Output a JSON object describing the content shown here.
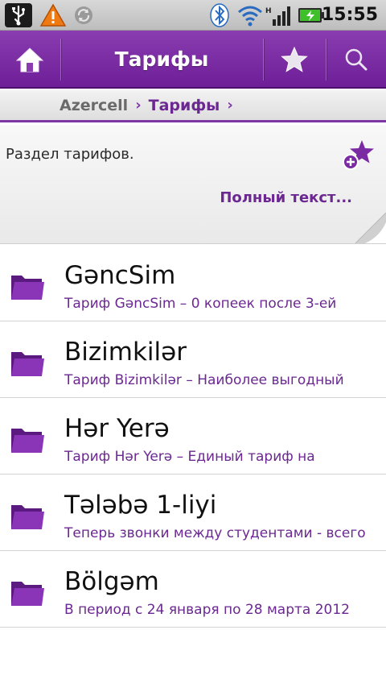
{
  "status_bar": {
    "time": "15:55",
    "icons": [
      "usb-icon",
      "warning-icon",
      "sync-icon",
      "bluetooth-icon",
      "wifi-icon",
      "signal-icon",
      "battery-charging-icon"
    ]
  },
  "action_bar": {
    "title": "Тарифы",
    "icons": [
      "home-icon",
      "star-icon",
      "search-icon"
    ],
    "accent_color": "#7a2aa3"
  },
  "breadcrumb": {
    "root": "Azercell",
    "current": "Тарифы",
    "separator": "›"
  },
  "description": {
    "text": "Раздел тарифов.",
    "full_text_link": "Полный текст...",
    "add_favorite_icon": "star-plus-icon"
  },
  "list": {
    "item_icon": "folder-icon",
    "items": [
      {
        "title": "GəncSim",
        "subtitle": "Тариф GəncSim – 0 копеек после 3-ей"
      },
      {
        "title": "Bizimkilər",
        "subtitle": "Тариф Bizimkilər – Наиболее выгодный"
      },
      {
        "title": "Hər Yerə",
        "subtitle": "Тариф Hər Yerə – Единый тариф на"
      },
      {
        "title": "Tələbə 1-liyi",
        "subtitle": "Теперь звонки между студентами - всего"
      },
      {
        "title": "Bölgəm",
        "subtitle": "В период с 24 января по 28 марта 2012"
      }
    ]
  }
}
